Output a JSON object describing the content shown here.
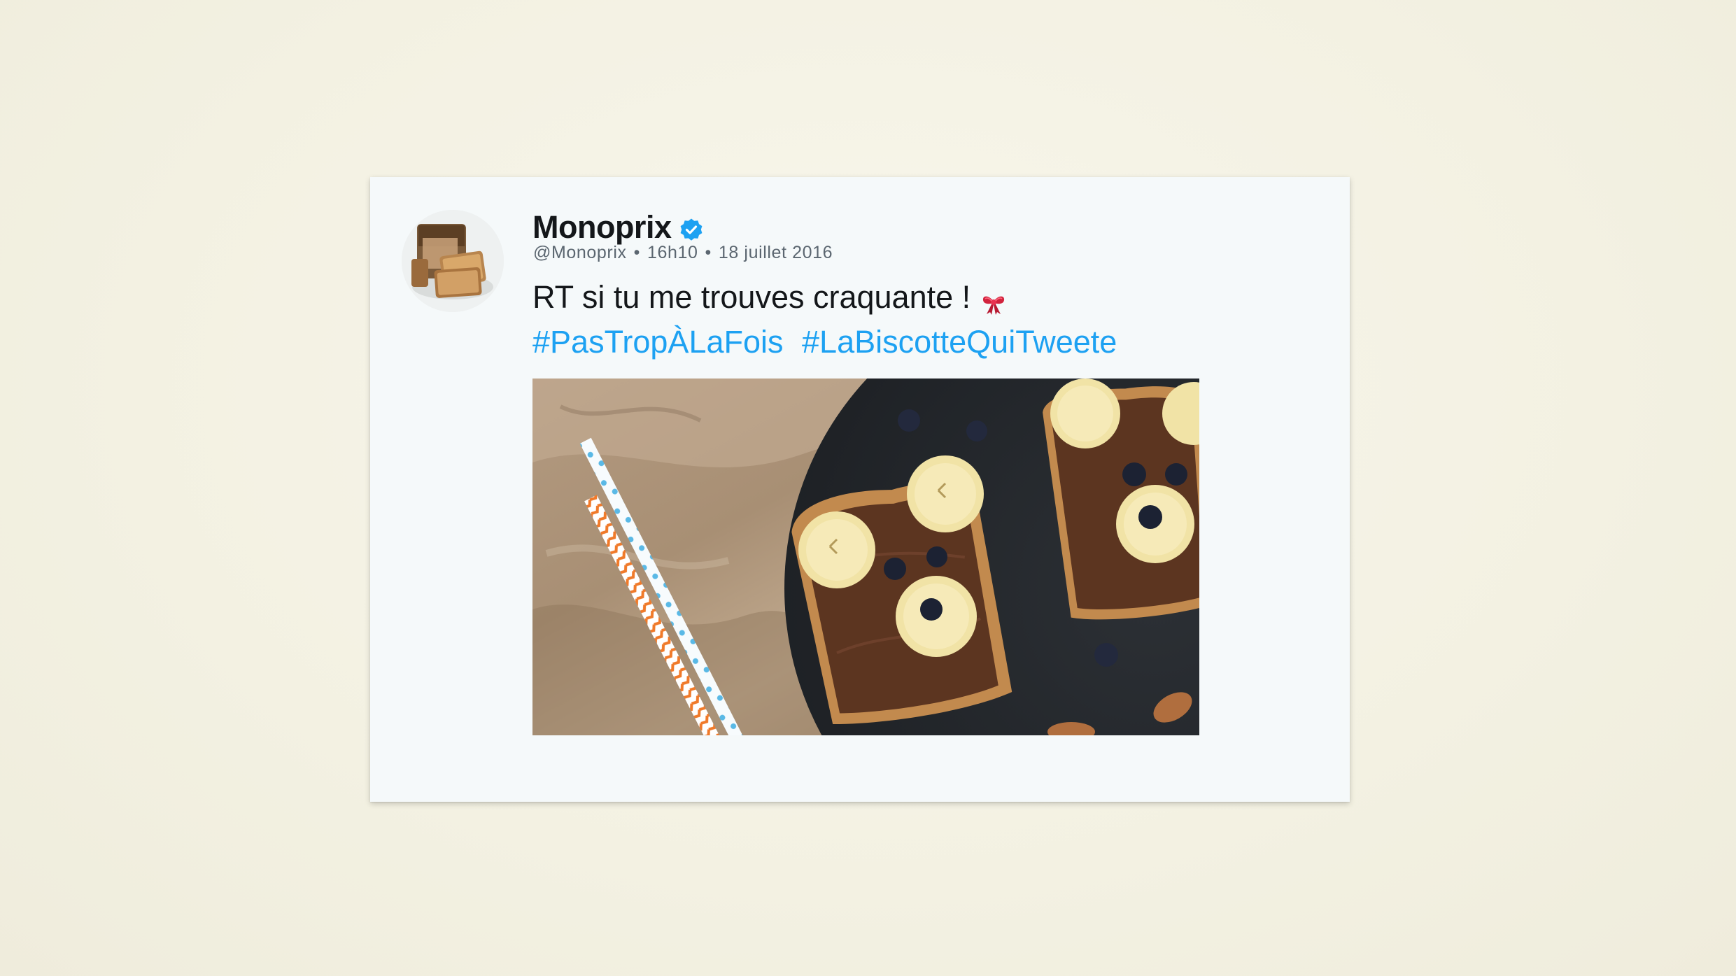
{
  "tweet": {
    "author_name": "Monoprix",
    "handle": "@Monoprix",
    "time": "16h10",
    "date": "18 juillet 2016",
    "separator": "•",
    "text": "RT si tu me trouves craquante !",
    "hashtags": [
      "#PasTropÀLaFois",
      "#LaBiscotteQuiTweete"
    ],
    "emoji_icon": "ribbon-bow-icon",
    "verified_icon": "verified-badge-icon",
    "media_subject": "bear-face-toasts-photo"
  },
  "colors": {
    "background": "#f3f1e2",
    "card": "#f5f9fa",
    "name": "#14171a",
    "meta": "#5b6670",
    "hashtag": "#1da1f2",
    "verified": "#1da1f2"
  }
}
